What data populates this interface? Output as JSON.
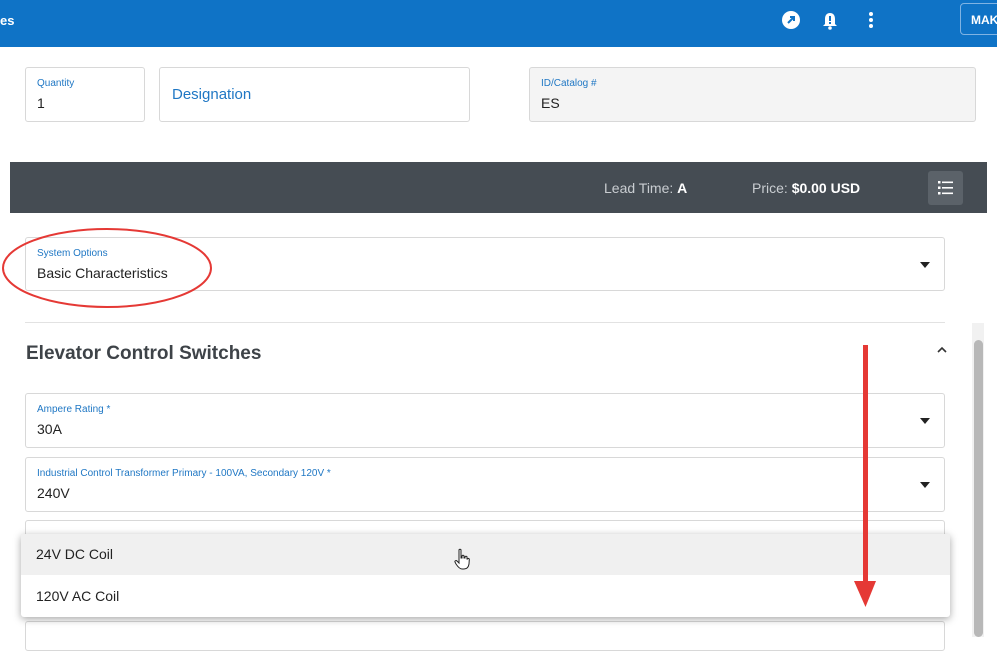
{
  "header": {
    "title_fragment": "es",
    "make_button": "MAK",
    "icons": [
      "open-external-icon",
      "bell-alert-icon",
      "more-vertical-icon"
    ],
    "brand_color": "#0f73c6"
  },
  "form": {
    "quantity": {
      "label": "Quantity",
      "value": "1"
    },
    "designation": {
      "label": "Designation"
    },
    "catalog": {
      "label": "ID/Catalog #",
      "value": "ES"
    }
  },
  "infobar": {
    "lead_time_label": "Lead Time:",
    "lead_time_value": "A",
    "price_label": "Price:",
    "price_value": "$0.00 USD",
    "bg_color": "#454c53"
  },
  "system_options": {
    "label": "System Options",
    "value": "Basic Characteristics"
  },
  "section": {
    "title": "Elevator Control Switches",
    "fields": [
      {
        "label": "Ampere Rating *",
        "value": "30A"
      },
      {
        "label": "Industrial Control Transformer Primary - 100VA, Secondary 120V *",
        "value": "240V"
      }
    ]
  },
  "dropdown": {
    "options": [
      "24V DC Coil",
      "120V AC Coil"
    ],
    "hovered_index": 0
  },
  "annotation_color": "#e53935"
}
